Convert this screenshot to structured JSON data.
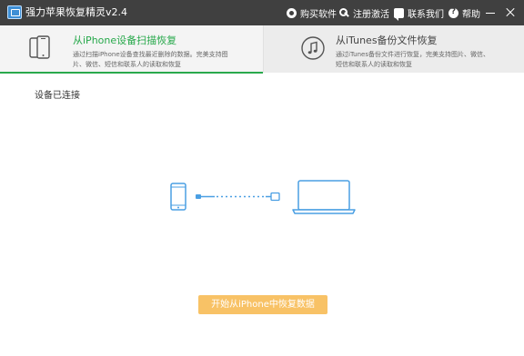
{
  "titlebar": {
    "app_title": "强力苹果恢复精灵v2.4",
    "menu": {
      "buy": "购买软件",
      "register": "注册激活",
      "contact": "联系我们",
      "help": "帮助"
    }
  },
  "tabs": [
    {
      "title": "从iPhone设备扫描恢复",
      "desc": "通过扫描iPhone设备查找最近删除的数据。完美支持图片、微信、短信和联系人的读取和恢复",
      "active": true
    },
    {
      "title": "从iTunes备份文件恢复",
      "desc": "通过iTunes备份文件进行恢复，完美支持图片、微信、短信和联系人的读取和恢复",
      "active": false
    }
  ],
  "main": {
    "status": "设备已连接",
    "start_button": "开始从iPhone中恢复数据"
  },
  "colors": {
    "titlebar_bg": "#404040",
    "accent_green": "#2aa94d",
    "illustration_blue": "#4a9fe3",
    "button_orange": "#f8c266"
  },
  "icons": {
    "tab1": "iphone-devices-icon",
    "tab2": "itunes-note-icon"
  }
}
